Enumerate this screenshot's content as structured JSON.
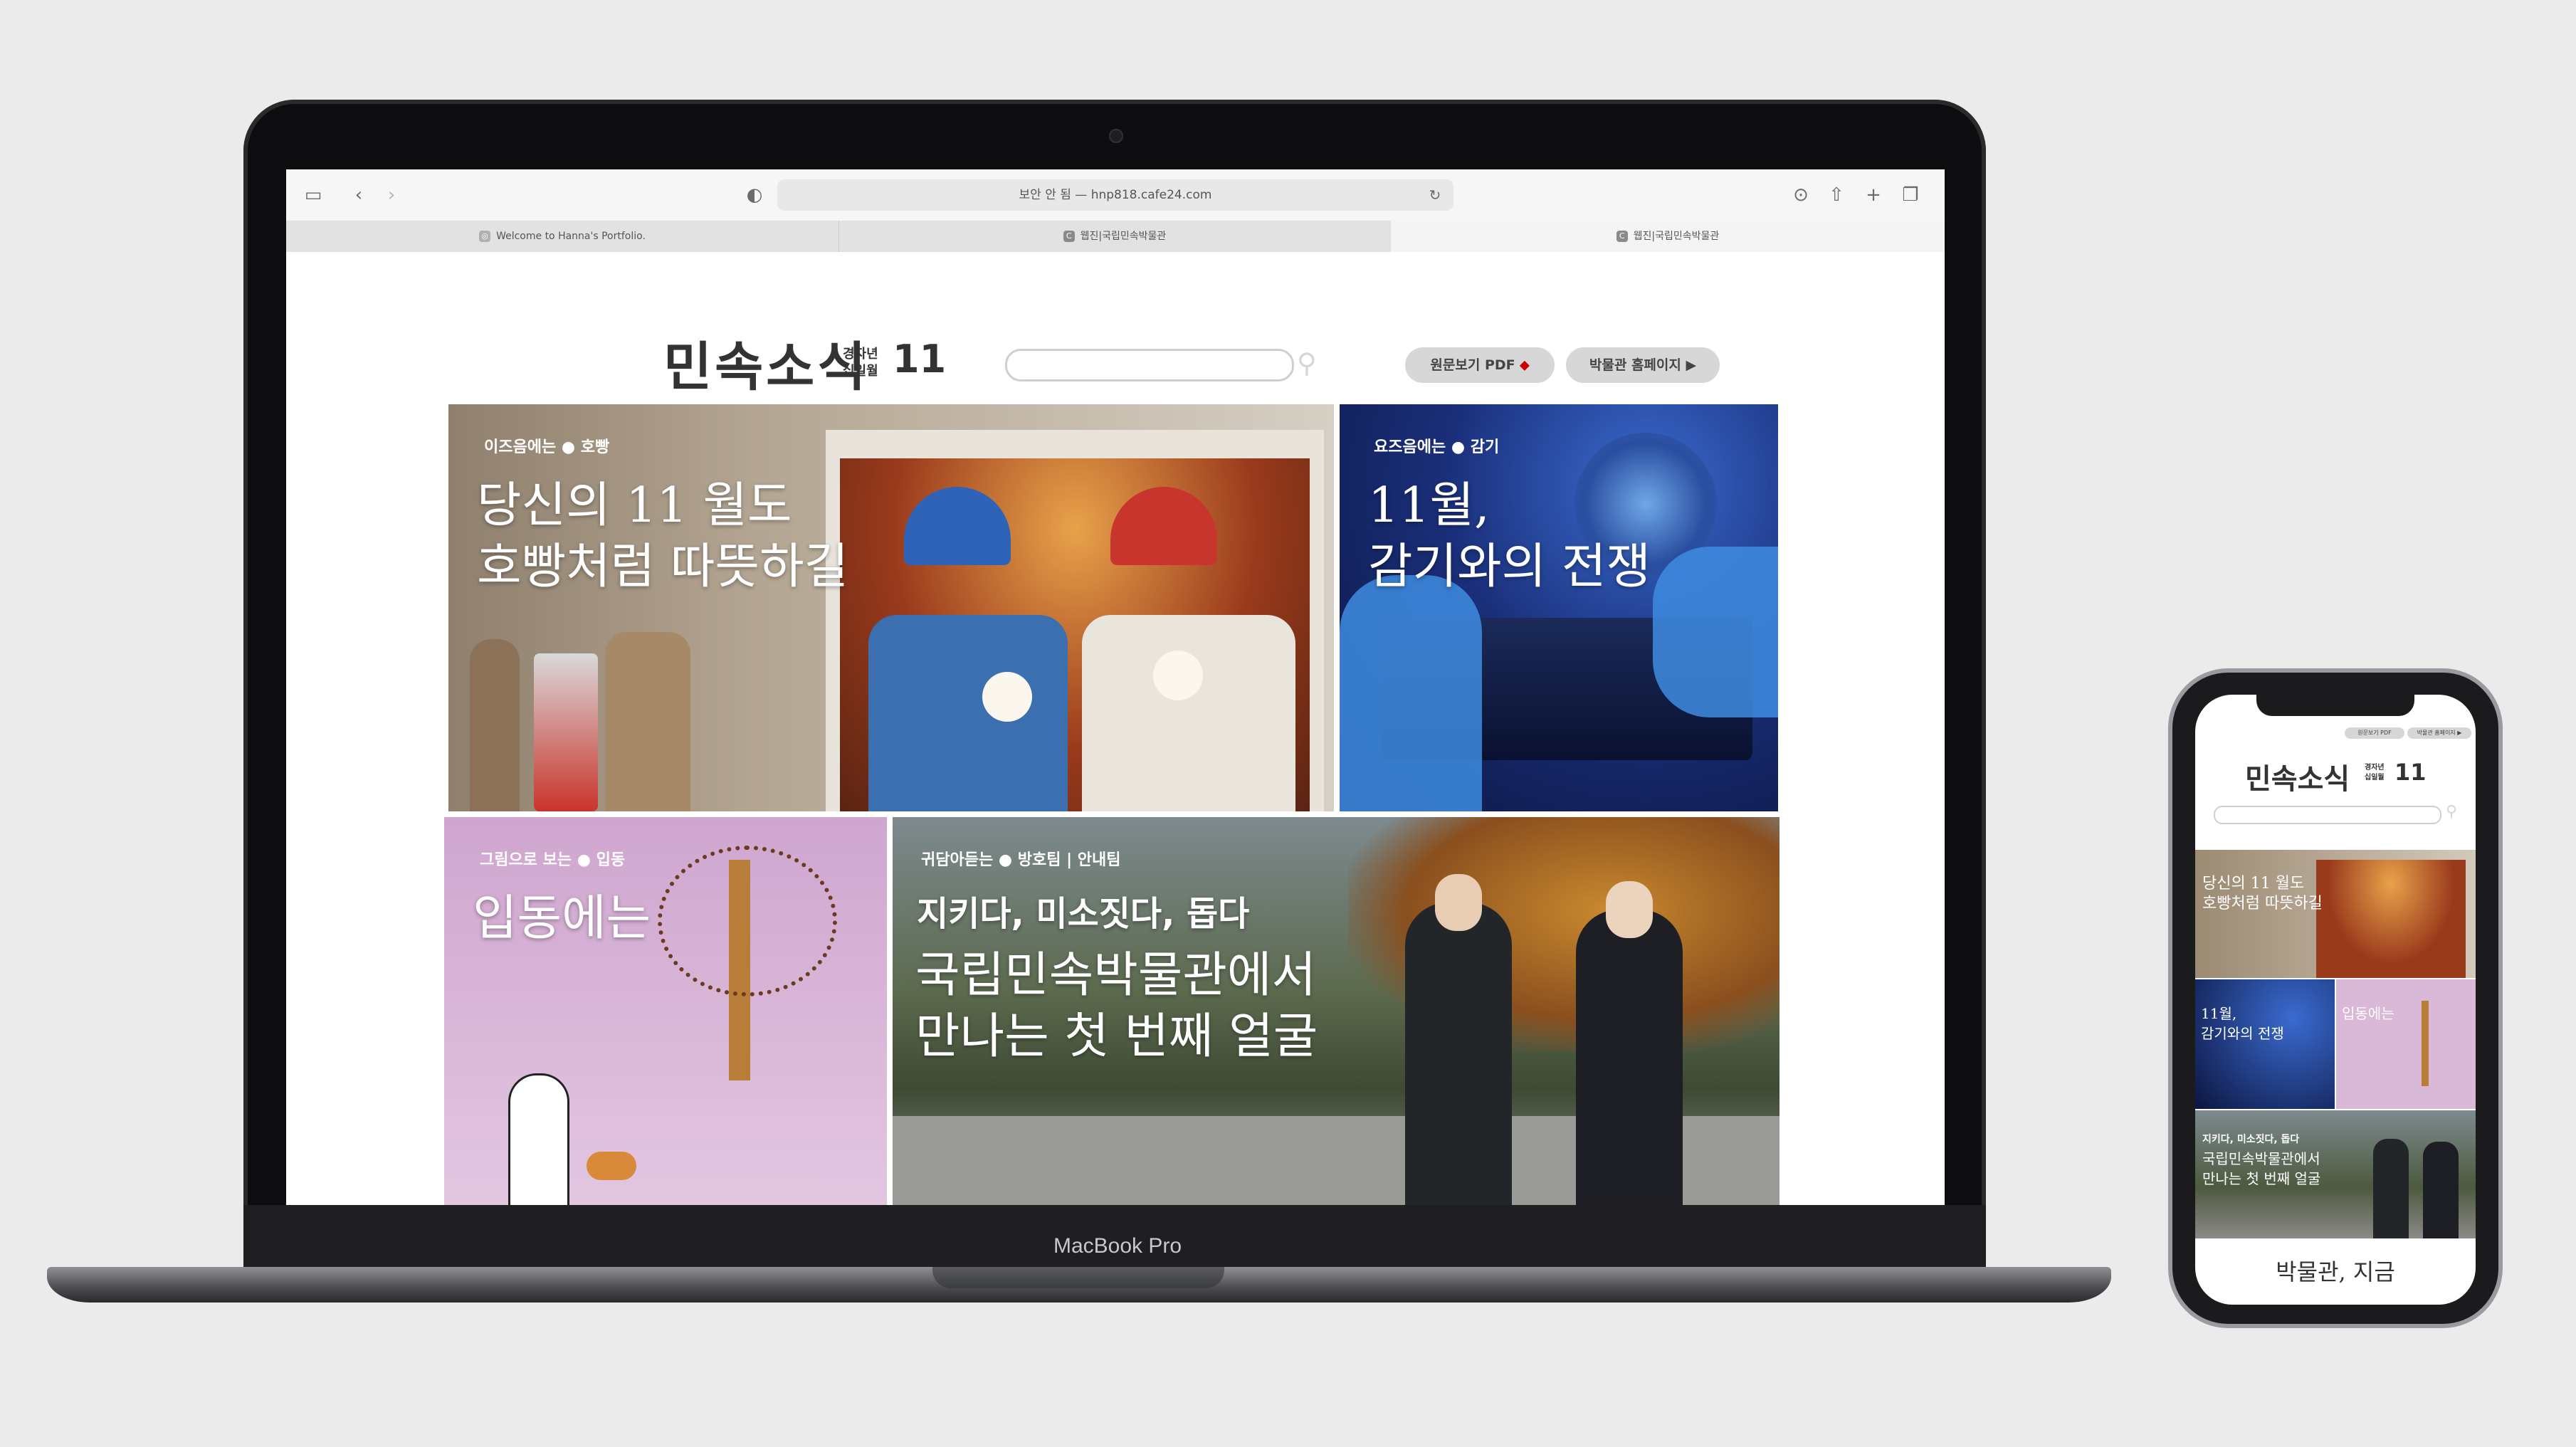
{
  "browser": {
    "url": "보안 안 됨 — hnp818.cafe24.com",
    "tabs": [
      {
        "label": "Welcome to Hanna's Portfolio.",
        "active": false
      },
      {
        "label": "웹진|국립민속박물관",
        "active": false
      },
      {
        "label": "웹진|국립민속박물관",
        "active": true
      }
    ]
  },
  "laptop": {
    "brand": "MacBook Pro"
  },
  "header": {
    "logo_title": "민속소식",
    "logo_sub_1": "경자년",
    "logo_sub_2": "십일월",
    "logo_number": "11",
    "pdf_button": "원문보기 PDF",
    "home_button": "박물관 홈페이지 ▶"
  },
  "tiles": [
    {
      "kicker": "이즈음에는 ● 호빵",
      "line1": "당신의 11 월도",
      "line2": "호빵처럼 따뜻하길"
    },
    {
      "kicker": "요즈음에는 ● 감기",
      "line1": "11월,",
      "line2": "감기와의 전쟁"
    },
    {
      "kicker": "그림으로 보는 ● 입동",
      "line1": "입동에는",
      "line2": ""
    },
    {
      "kicker": "귀담아듣는 ● 방호팀 | 안내팀",
      "bold": "지키다, 미소짓다, 돕다",
      "line1": "국립민속박물관에서",
      "line2": "만나는 첫 번째 얼굴"
    }
  ],
  "phone": {
    "pdf_button": "원문보기 PDF",
    "home_button": "박물관 홈페이지 ▶",
    "tile1_line1": "당신의 11 월도",
    "tile1_line2": "호빵처럼 따뜻하길",
    "tile2_line1": "11월,",
    "tile2_line2": "감기와의 전쟁",
    "tile3_line1": "입동에는",
    "tile4_bold": "지키다, 미소짓다, 돕다",
    "tile4_line1": "국립민속박물관에서",
    "tile4_line2": "만나는 첫 번째 얼굴",
    "footer": "박물관, 지금"
  },
  "colors": {
    "background": "#ebebeb",
    "tile_hoppang": "#9c8a72",
    "tile_flu": "#1e3a8c",
    "tile_ipdong": "#d9b8d8",
    "tile_guard": "#4d5a3e"
  }
}
